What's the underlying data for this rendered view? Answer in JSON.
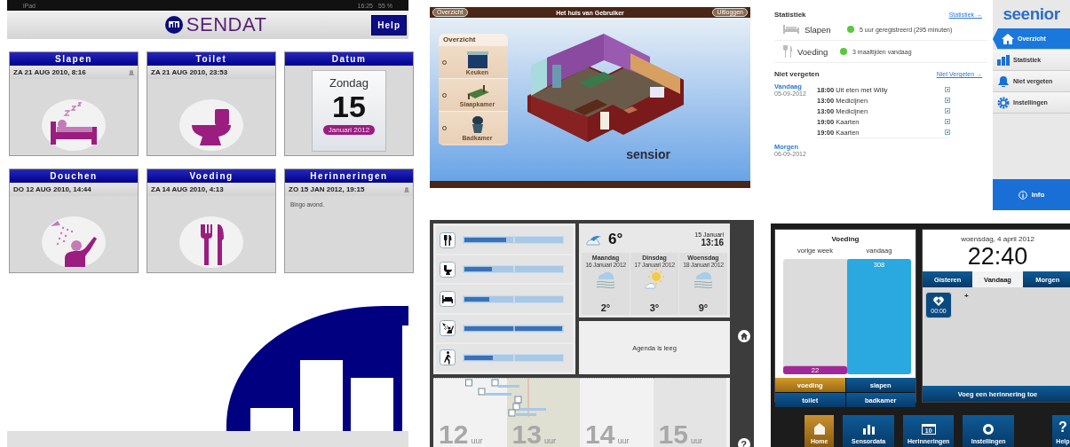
{
  "sendat": {
    "status_bar": {
      "device": "iPad",
      "time": "16:25",
      "battery": "55 %"
    },
    "logo": "SENDAT",
    "help_button": "Help",
    "cards": [
      {
        "title": "Slapen",
        "kind": "bed",
        "timestamp": "ZA 21 AUG 2010, 8:16",
        "alarm": true
      },
      {
        "title": "Toilet",
        "kind": "toilet",
        "timestamp": "ZA 21 AUG 2010, 23:53",
        "alarm": false
      },
      {
        "title": "Datum",
        "kind": "calendar",
        "weekday": "Zondag",
        "day": "15",
        "month": "Januari 2012"
      },
      {
        "title": "Douchen",
        "kind": "shower",
        "timestamp": "DO 12 AUG 2010, 14:44",
        "alarm": false
      },
      {
        "title": "Voeding",
        "kind": "meal",
        "timestamp": "ZA 14 AUG 2010, 4:13",
        "alarm": false
      },
      {
        "title": "Herinneringen",
        "kind": "note",
        "timestamp": "ZO 15 JAN 2012, 19:15",
        "alarm": true,
        "note": "Bingo avond."
      }
    ]
  },
  "sensior": {
    "back_button": "Overzicht",
    "title": "Het huis van Gebruiker",
    "logout_button": "Uitloggen",
    "panel_title": "Overzicht",
    "rooms": [
      {
        "name": "Keuken",
        "kind": "kitchen",
        "selected": false
      },
      {
        "name": "Slaapkamer",
        "kind": "bedroom",
        "selected": false
      },
      {
        "name": "Badkamer",
        "kind": "bathroom",
        "selected": false
      }
    ],
    "logo": "sensior"
  },
  "seenior": {
    "stats_title": "Statistiek",
    "stats_link": "Statistiek →",
    "stats": [
      {
        "kind": "sleep",
        "label": "Slapen",
        "summary": "5 uur geregistreerd (295 minuten)"
      },
      {
        "kind": "meal",
        "label": "Voeding",
        "summary": "3 maaltijden vandaag"
      }
    ],
    "reminders_title": "Niet vergeten",
    "reminders_link": "Niet Vergeten →",
    "days": [
      {
        "label": "Vandaag",
        "date": "05-09-2012",
        "items": [
          "**18:00** Uit eten met Willy",
          "**13:00** Medicijnen",
          "**13:00** Medicijnen",
          "**19:00** Kaarten",
          "**19:00** Kaarten"
        ]
      },
      {
        "label": "Morgen",
        "date": "06-09-2012"
      }
    ],
    "logo": "seenior",
    "nav": [
      {
        "label": "Overzicht",
        "kind": "home",
        "selected": true
      },
      {
        "label": "Statistiek",
        "kind": "stats",
        "selected": false
      },
      {
        "label": "Niet vergeten",
        "kind": "bell",
        "selected": false
      },
      {
        "label": "Instellingen",
        "kind": "gear",
        "selected": false
      }
    ],
    "info_button": "Info"
  },
  "dashboard": {
    "activities": [
      {
        "kind": "meal",
        "level": 0.43
      },
      {
        "kind": "toilet",
        "level": 0.28
      },
      {
        "kind": "bed",
        "level": 0.25
      },
      {
        "kind": "shower",
        "level": 1
      },
      {
        "kind": "walk",
        "level": 0.29
      }
    ],
    "weather": {
      "temperature": "6°",
      "date": "15 Januari",
      "time": "13:16",
      "forecast": [
        {
          "day": "Maandag",
          "date": "16 Januari 2012",
          "kind": "rain",
          "temperature": "2°"
        },
        {
          "day": "Dinsdag",
          "date": "17 Januari 2012",
          "kind": "sun",
          "temperature": "3°"
        },
        {
          "day": "Woensdag",
          "date": "18 Januari 2012",
          "kind": "rain",
          "temperature": "9°"
        }
      ]
    },
    "agenda": "Agenda is leeg",
    "help_button": "?",
    "timeline": [
      {
        "hour": "12",
        "unit": "uur"
      },
      {
        "hour": "13",
        "unit": "uur"
      },
      {
        "hour": "14",
        "unit": "uur"
      },
      {
        "hour": "15",
        "unit": "uur"
      }
    ]
  },
  "dark": {
    "chart": {
      "chart_data": {
        "type": "bar",
        "title": "Voeding",
        "categories": [
          "vorige week",
          "vandaag"
        ],
        "values": [
          22,
          308
        ],
        "data_labels": true
      }
    },
    "sensor_buttons": [
      {
        "label": "voeding",
        "selected": true
      },
      {
        "label": "slapen",
        "selected": false
      },
      {
        "label": "toilet",
        "selected": false
      },
      {
        "label": "badkamer",
        "selected": false
      }
    ],
    "date": "woensdag, 4 april 2012",
    "time": "22:40",
    "tabs": [
      {
        "label": "Gisteren",
        "selected": false
      },
      {
        "label": "Vandaag",
        "selected": true
      },
      {
        "label": "Morgen",
        "selected": false
      }
    ],
    "reminder_time": "00:00",
    "add_mark": "+",
    "add_button": "Voeg een herinnering toe",
    "nav": [
      {
        "label": "Home",
        "kind": "home",
        "selected": true
      },
      {
        "label": "Sensordata",
        "kind": "chart",
        "selected": false
      },
      {
        "label": "Herinneringen",
        "kind": "calendar",
        "day": "10",
        "selected": false
      },
      {
        "label": "Instellingen",
        "kind": "gear",
        "selected": false
      },
      {
        "label": "Help",
        "kind": "help",
        "glyph": "?",
        "selected": false
      }
    ]
  }
}
